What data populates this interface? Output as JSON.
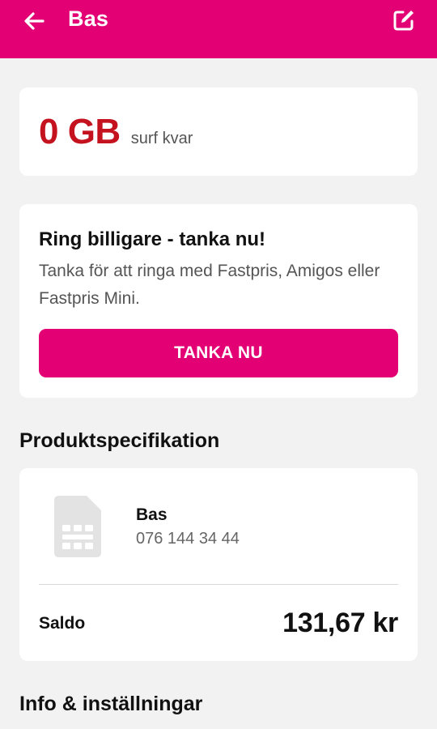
{
  "colors": {
    "brand": "#e20074",
    "surf_value": "#c4121f",
    "background": "#f2f2f2"
  },
  "header": {
    "title": "Bas",
    "back_icon": "arrow-left-icon",
    "edit_icon": "edit-icon"
  },
  "surf": {
    "value": "0 GB",
    "label": "surf kvar"
  },
  "promo": {
    "title": "Ring billigare - tanka nu!",
    "text": "Tanka för att ringa med Fastpris, Amigos eller Fastpris Mini.",
    "button_label": "TANKA NU"
  },
  "sections": {
    "product_spec": "Produktspecifikation",
    "info_settings": "Info & inställningar"
  },
  "product": {
    "icon": "sim-card-icon",
    "name": "Bas",
    "number": "076 144 34 44",
    "saldo_label": "Saldo",
    "saldo_value": "131,67 kr"
  }
}
